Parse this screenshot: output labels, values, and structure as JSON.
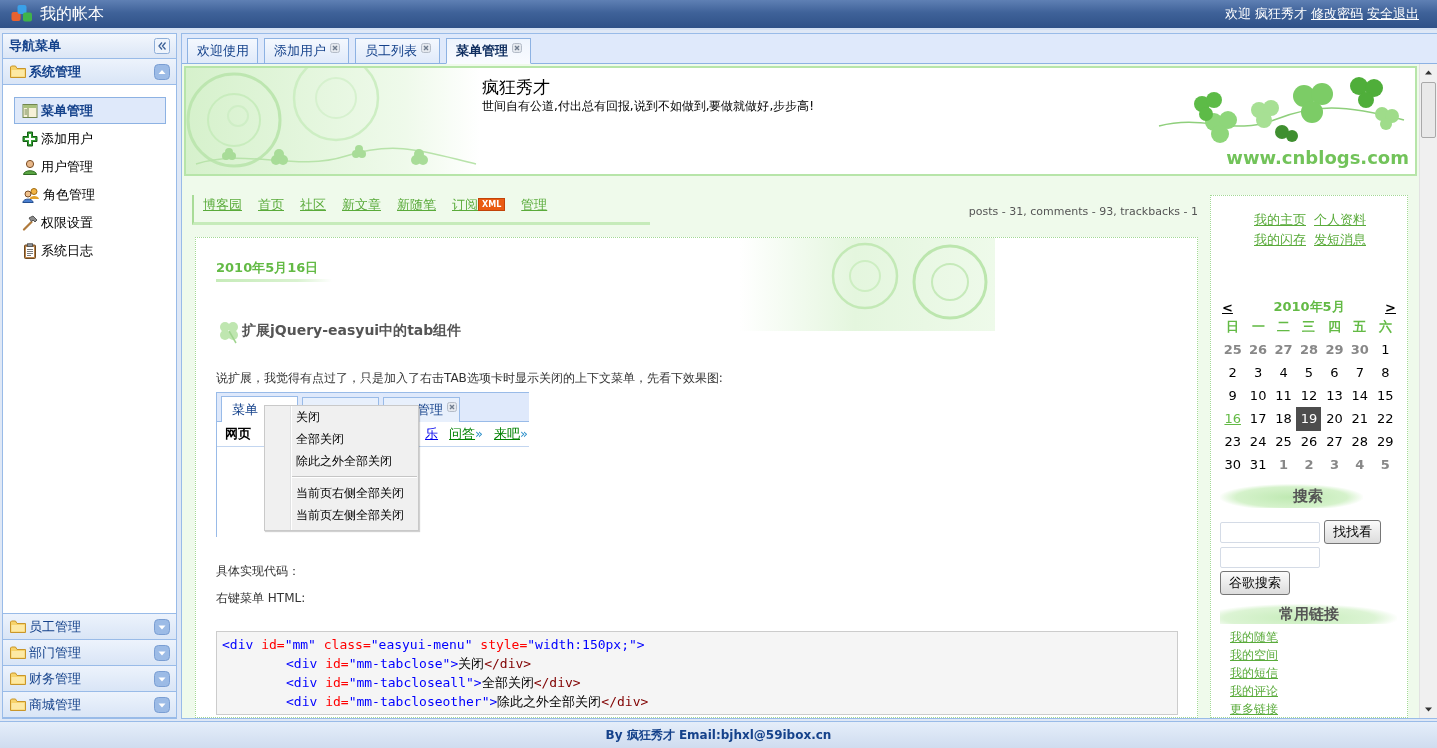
{
  "header": {
    "title": "我的帐本",
    "greeting": "欢迎",
    "user": "疯狂秀才",
    "links": [
      "修改密码",
      "安全退出"
    ]
  },
  "sidebar": {
    "title": "导航菜单",
    "groups": [
      {
        "label": "系统管理",
        "expanded": true,
        "items": [
          {
            "label": "菜单管理",
            "selected": true
          },
          {
            "label": "添加用户",
            "selected": false
          },
          {
            "label": "用户管理",
            "selected": false
          },
          {
            "label": "角色管理",
            "selected": false
          },
          {
            "label": "权限设置",
            "selected": false
          },
          {
            "label": "系统日志",
            "selected": false
          }
        ]
      },
      {
        "label": "员工管理",
        "expanded": false
      },
      {
        "label": "部门管理",
        "expanded": false
      },
      {
        "label": "财务管理",
        "expanded": false
      },
      {
        "label": "商城管理",
        "expanded": false
      }
    ]
  },
  "tabs": [
    {
      "label": "欢迎使用",
      "closable": false,
      "selected": false
    },
    {
      "label": "添加用户",
      "closable": true,
      "selected": false
    },
    {
      "label": "员工列表",
      "closable": true,
      "selected": false
    },
    {
      "label": "菜单管理",
      "closable": true,
      "selected": true
    }
  ],
  "blog": {
    "title": "疯狂秀才",
    "subtitle": "世间自有公道,付出总有回报,说到不如做到,要做就做好,步步高!",
    "banner_text": "www.cnblogs.com",
    "nav": [
      {
        "label": "博客园"
      },
      {
        "label": "首页"
      },
      {
        "label": "社区"
      },
      {
        "label": "新文章"
      },
      {
        "label": "新随笔"
      },
      {
        "label": "订阅",
        "badge": "XML"
      },
      {
        "label": "管理"
      }
    ],
    "stats": "posts - 31, comments - 93, trackbacks - 1",
    "post": {
      "date": "2010年5月16日",
      "title": "扩展jQuery-easyui中的tab组件",
      "intro": "说扩展，我觉得有点过了，只是加入了右击TAB选项卡时显示关闭的上下文菜单，先看下效果图:",
      "figure": {
        "tabs": [
          {
            "label": "菜单",
            "selected": true,
            "close_icon": false
          },
          {
            "selected": false,
            "close_icon": false
          },
          {
            "label": "管理",
            "selected": false,
            "close_icon": true
          }
        ],
        "heading": "网页",
        "links": [
          {
            "label": "乐",
            "color": "#0000ee"
          },
          {
            "label": "问答",
            "suffix": "»",
            "color": "#008000"
          },
          {
            "label": "来吧",
            "suffix": "»",
            "color": "#008000"
          }
        ],
        "menu": [
          {
            "kind": "item",
            "label": "关闭"
          },
          {
            "kind": "item",
            "label": "全部关闭"
          },
          {
            "kind": "item",
            "label": "除此之外全部关闭"
          },
          {
            "kind": "separator"
          },
          {
            "kind": "item",
            "label": "当前页右侧全部关闭"
          },
          {
            "kind": "item",
            "label": "当前页左侧全部关闭"
          }
        ]
      },
      "paragraphs": [
        "具体实现代码：",
        "右键菜单  HTML:"
      ],
      "code": [
        {
          "tokens": [
            {
              "kind": "tag",
              "text": "<div"
            },
            {
              "kind": "attr",
              "text": " id="
            },
            {
              "kind": "value",
              "text": "\"mm\""
            },
            {
              "kind": "attr",
              "text": " class="
            },
            {
              "kind": "value",
              "text": "\"easyui-menu\""
            },
            {
              "kind": "attr",
              "text": " style="
            },
            {
              "kind": "value",
              "text": "\"width:150px;\""
            },
            {
              "kind": "tag",
              "text": ">"
            }
          ],
          "children": [
            {
              "tokens": [
                {
                  "kind": "tag",
                  "text": "<div"
                },
                {
                  "kind": "attr",
                  "text": " id="
                },
                {
                  "kind": "value",
                  "text": "\"mm-tabclose\""
                },
                {
                  "kind": "tag",
                  "text": ">"
                },
                {
                  "kind": "text",
                  "text": "关闭"
                },
                {
                  "kind": "close_tag",
                  "text": "</div>"
                }
              ]
            },
            {
              "tokens": [
                {
                  "kind": "tag",
                  "text": "<div"
                },
                {
                  "kind": "attr",
                  "text": " id="
                },
                {
                  "kind": "value",
                  "text": "\"mm-tabcloseall\""
                },
                {
                  "kind": "tag",
                  "text": ">"
                },
                {
                  "kind": "text",
                  "text": "全部关闭"
                },
                {
                  "kind": "close_tag",
                  "text": "</div>"
                }
              ]
            },
            {
              "tokens": [
                {
                  "kind": "tag",
                  "text": "<div"
                },
                {
                  "kind": "attr",
                  "text": " id="
                },
                {
                  "kind": "value",
                  "text": "\"mm-tabcloseother\""
                },
                {
                  "kind": "tag",
                  "text": ">"
                },
                {
                  "kind": "text",
                  "text": "除此之外全部关闭"
                },
                {
                  "kind": "close_tag",
                  "text": "</div>"
                }
              ]
            }
          ]
        }
      ]
    }
  },
  "blog_sidebar": {
    "links": [
      "我的主页",
      "个人资料",
      "我的闪存",
      "发短消息"
    ],
    "calendar": {
      "prev": "<",
      "title": "2010年5月",
      "next": ">",
      "weekdays": [
        "日",
        "一",
        "二",
        "三",
        "四",
        "五",
        "六"
      ],
      "days": [
        {
          "label": "25",
          "kind": "other"
        },
        {
          "label": "26",
          "kind": "other"
        },
        {
          "label": "27",
          "kind": "other"
        },
        {
          "label": "28",
          "kind": "other"
        },
        {
          "label": "29",
          "kind": "other"
        },
        {
          "label": "30",
          "kind": "other"
        },
        {
          "label": "1",
          "kind": "day"
        },
        {
          "label": "2",
          "kind": "day"
        },
        {
          "label": "3",
          "kind": "day"
        },
        {
          "label": "4",
          "kind": "day"
        },
        {
          "label": "5",
          "kind": "day"
        },
        {
          "label": "6",
          "kind": "day"
        },
        {
          "label": "7",
          "kind": "day"
        },
        {
          "label": "8",
          "kind": "day"
        },
        {
          "label": "9",
          "kind": "day"
        },
        {
          "label": "10",
          "kind": "day"
        },
        {
          "label": "11",
          "kind": "day"
        },
        {
          "label": "12",
          "kind": "day"
        },
        {
          "label": "13",
          "kind": "day"
        },
        {
          "label": "14",
          "kind": "day"
        },
        {
          "label": "15",
          "kind": "day"
        },
        {
          "label": "16",
          "kind": "post"
        },
        {
          "label": "17",
          "kind": "day"
        },
        {
          "label": "18",
          "kind": "day"
        },
        {
          "label": "19",
          "kind": "today"
        },
        {
          "label": "20",
          "kind": "day"
        },
        {
          "label": "21",
          "kind": "day"
        },
        {
          "label": "22",
          "kind": "day"
        },
        {
          "label": "23",
          "kind": "day"
        },
        {
          "label": "24",
          "kind": "day"
        },
        {
          "label": "25",
          "kind": "day"
        },
        {
          "label": "26",
          "kind": "day"
        },
        {
          "label": "27",
          "kind": "day"
        },
        {
          "label": "28",
          "kind": "day"
        },
        {
          "label": "29",
          "kind": "day"
        },
        {
          "label": "30",
          "kind": "day"
        },
        {
          "label": "31",
          "kind": "day"
        },
        {
          "label": "1",
          "kind": "other"
        },
        {
          "label": "2",
          "kind": "other"
        },
        {
          "label": "3",
          "kind": "other"
        },
        {
          "label": "4",
          "kind": "other"
        },
        {
          "label": "5",
          "kind": "other"
        }
      ]
    },
    "search": {
      "title": "搜索",
      "forms": [
        {
          "button": "找找看"
        },
        {
          "button": "谷歌搜索"
        }
      ]
    },
    "common_links": {
      "title": "常用链接",
      "links": [
        "我的随笔",
        "我的空间",
        "我的短信",
        "我的评论",
        "更多链接"
      ]
    }
  },
  "footer": {
    "text": "By 疯狂秀才 Email:bjhxl@59ibox.cn"
  }
}
